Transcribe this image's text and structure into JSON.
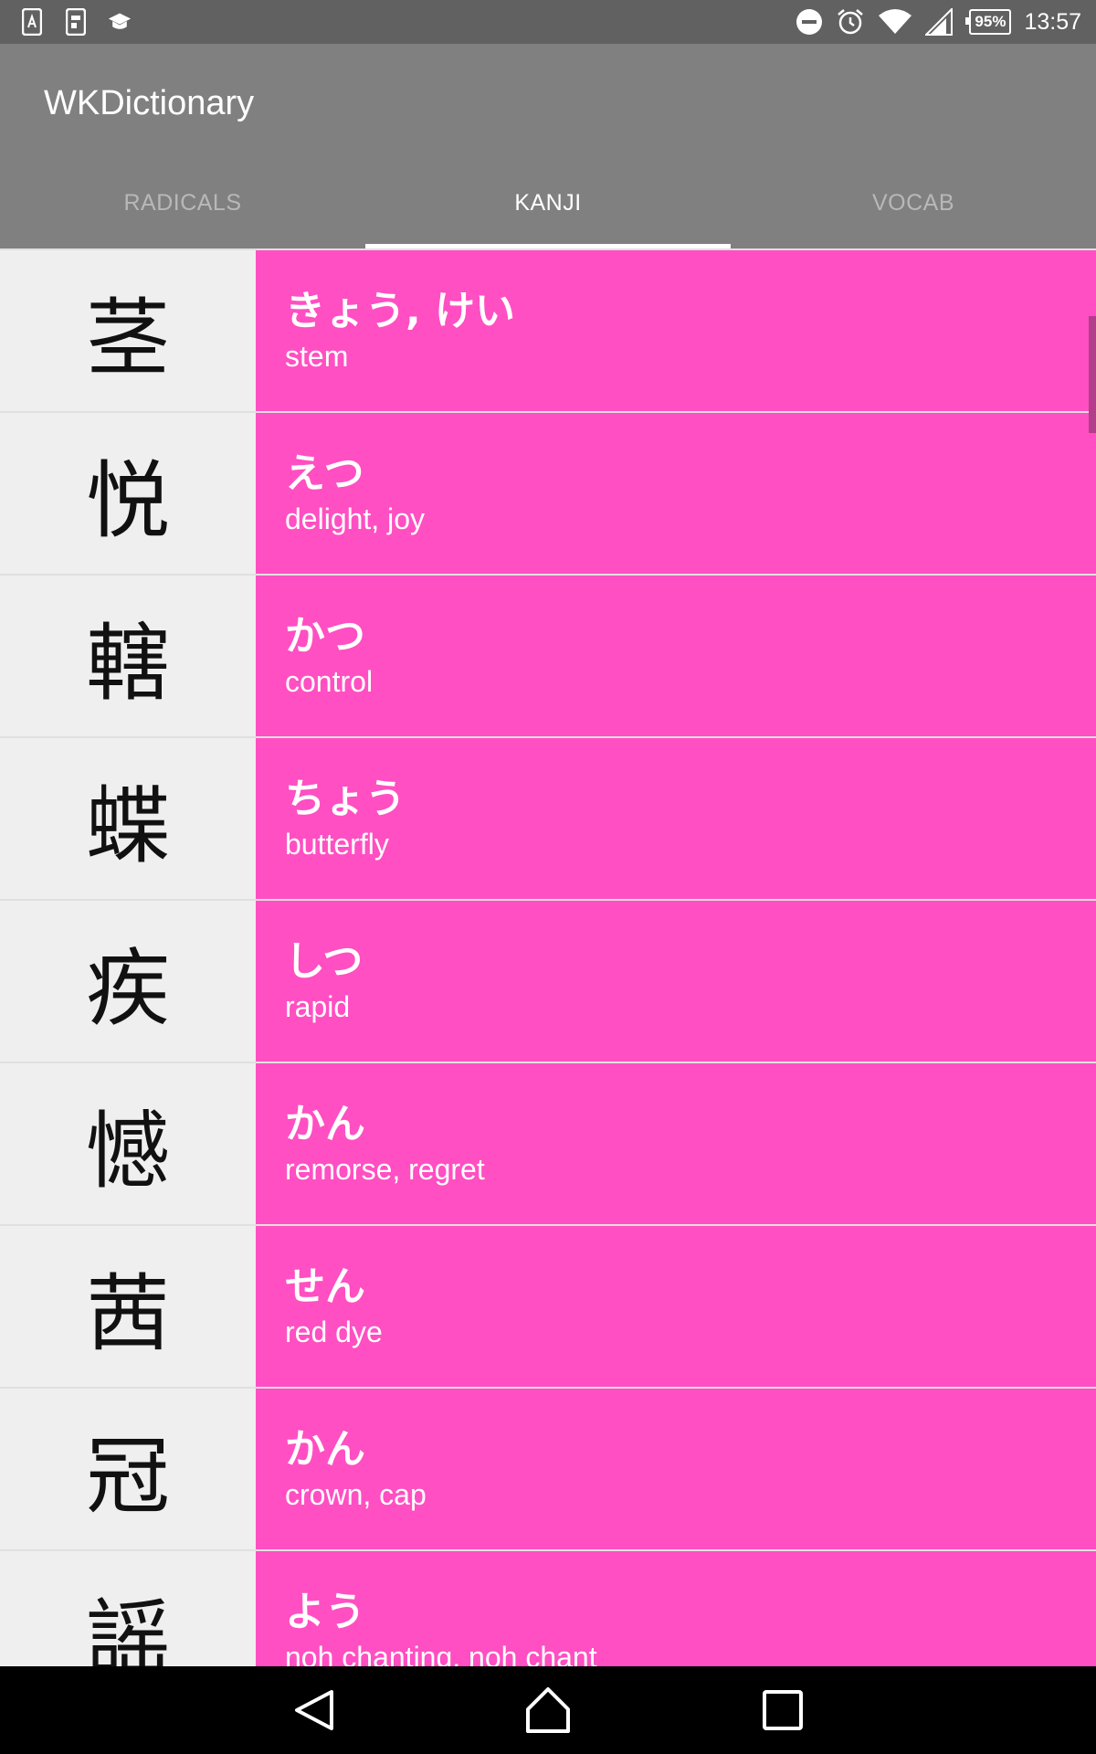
{
  "status_bar": {
    "left_icons": [
      "sim-icon",
      "screenshot-notification-icon",
      "school-icon"
    ],
    "right_icons": [
      "do-not-disturb-icon",
      "alarm-icon",
      "wifi-icon",
      "signal-icon"
    ],
    "battery": "95%",
    "time": "13:57"
  },
  "app_bar": {
    "title": "WKDictionary",
    "tabs": [
      {
        "label": "RADICALS",
        "active": false
      },
      {
        "label": "KANJI",
        "active": true
      },
      {
        "label": "VOCAB",
        "active": false
      }
    ]
  },
  "kanji_list": [
    {
      "kanji": "茎",
      "reading": "きょう, けい",
      "meaning": "stem"
    },
    {
      "kanji": "悦",
      "reading": "えつ",
      "meaning": "delight, joy"
    },
    {
      "kanji": "轄",
      "reading": "かつ",
      "meaning": "control"
    },
    {
      "kanji": "蝶",
      "reading": "ちょう",
      "meaning": "butterfly"
    },
    {
      "kanji": "疾",
      "reading": "しつ",
      "meaning": "rapid"
    },
    {
      "kanji": "憾",
      "reading": "かん",
      "meaning": "remorse, regret"
    },
    {
      "kanji": "茜",
      "reading": "せん",
      "meaning": "red dye"
    },
    {
      "kanji": "冠",
      "reading": "かん",
      "meaning": "crown, cap"
    },
    {
      "kanji": "謡",
      "reading": "よう",
      "meaning": "noh chanting, noh chant"
    }
  ],
  "colors": {
    "status_bar": "#616161",
    "app_bar": "#808080",
    "kanji_cell": "#efefef",
    "info_cell": "#ff4fc2",
    "nav_bar": "#000000"
  },
  "nav_bar": {
    "icons": [
      "back-icon",
      "home-icon",
      "recents-icon"
    ]
  }
}
